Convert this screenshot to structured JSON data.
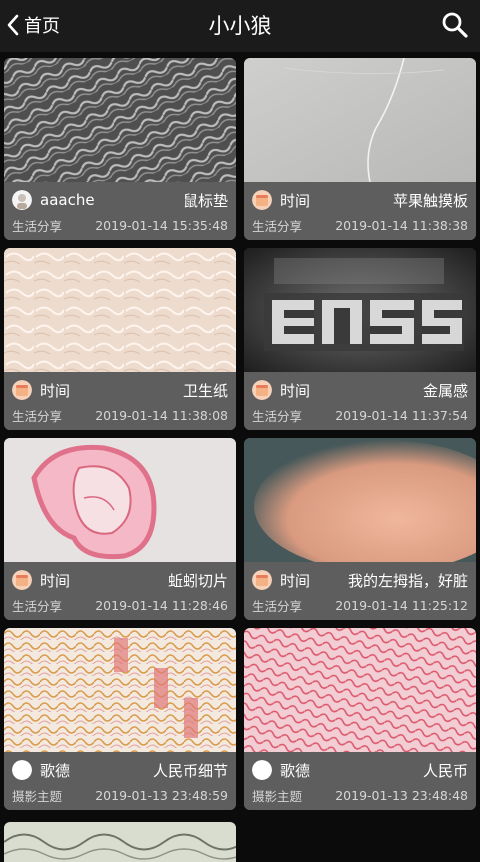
{
  "header": {
    "back_label": "首页",
    "title": "小小狼",
    "back_icon": "chevron-left-icon",
    "search_icon": "search-icon"
  },
  "posts": [
    {
      "author": "aaache",
      "title": "鼠标垫",
      "category": "生活分享",
      "time": "2019-01-14 15:35:48",
      "image": "fabric-fibers"
    },
    {
      "author": "时间",
      "title": "苹果触摸板",
      "category": "生活分享",
      "time": "2019-01-14 11:38:38",
      "image": "gray-surface"
    },
    {
      "author": "时间",
      "title": "卫生纸",
      "category": "生活分享",
      "time": "2019-01-14 11:38:08",
      "image": "tissue-paper"
    },
    {
      "author": "时间",
      "title": "金属感",
      "category": "生活分享",
      "time": "2019-01-14 11:37:54",
      "image": "lens-text"
    },
    {
      "author": "时间",
      "title": "蚯蚓切片",
      "category": "生活分享",
      "time": "2019-01-14 11:28:46",
      "image": "worm-slice"
    },
    {
      "author": "时间",
      "title": "我的左拇指，好脏",
      "category": "生活分享",
      "time": "2019-01-14 11:25:12",
      "image": "thumb-skin"
    },
    {
      "author": "歌德",
      "title": "人民币细节",
      "category": "摄影主题",
      "time": "2019-01-13 23:48:59",
      "image": "banknote-detail"
    },
    {
      "author": "歌德",
      "title": "人民币",
      "category": "摄影主题",
      "time": "2019-01-13 23:48:48",
      "image": "banknote-pink"
    }
  ],
  "colors": {
    "background": "#0b0b0b",
    "topbar": "#1b1b1b",
    "card_info": "#5e5e5e"
  }
}
